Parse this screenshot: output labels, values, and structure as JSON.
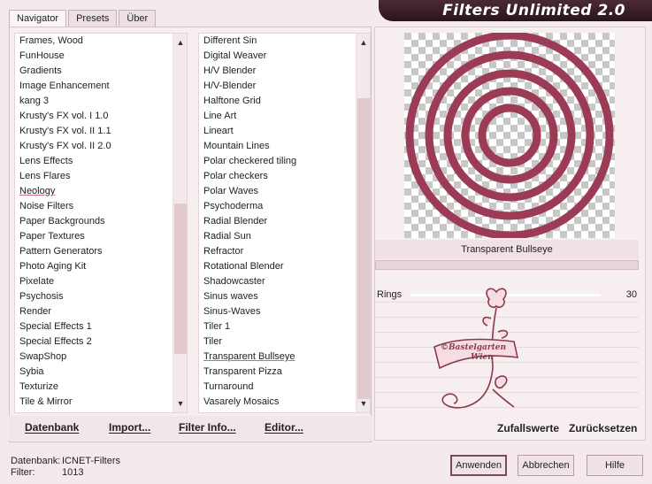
{
  "app": {
    "title": "Filters Unlimited 2.0"
  },
  "tabs": [
    "Navigator",
    "Presets",
    "Über"
  ],
  "categories": [
    "Frames, Wood",
    "FunHouse",
    "Gradients",
    "Image Enhancement",
    "kang 3",
    "Krusty's FX vol. I 1.0",
    "Krusty's FX vol. II 1.1",
    "Krusty's FX vol. II 2.0",
    "Lens Effects",
    "Lens Flares",
    "Neology",
    "Noise Filters",
    "Paper Backgrounds",
    "Paper Textures",
    "Pattern Generators",
    "Photo Aging Kit",
    "Pixelate",
    "Psychosis",
    "Render",
    "Special Effects 1",
    "Special Effects 2",
    "SwapShop",
    "Sybia",
    "Texturize",
    "Tile & Mirror"
  ],
  "filters": [
    "Different Sin",
    "Digital Weaver",
    "H/V Blender",
    "H/V-Blender",
    "Halftone Grid",
    "Line Art",
    "Lineart",
    "Mountain Lines",
    "Polar checkered tiling",
    "Polar checkers",
    "Polar Waves",
    "Psychoderma",
    "Radial Blender",
    "Radial Sun",
    "Refractor",
    "Rotational Blender",
    "Shadowcaster",
    "Sinus waves",
    "Sinus-Waves",
    "Tiler 1",
    "Tiler",
    "Transparent Bullseye",
    "Transparent Pizza",
    "Turnaround",
    "Vasarely Mosaics"
  ],
  "selected": {
    "category": "Neology",
    "filter": "Transparent Bullseye"
  },
  "toolbar": {
    "datenbank": "Datenbank",
    "import": "Import...",
    "filterinfo": "Filter Info...",
    "editor": "Editor..."
  },
  "preview": {
    "filter_name": "Transparent Bullseye",
    "ring_color": "#9b3b55"
  },
  "params": [
    {
      "label": "Rings",
      "value": "30"
    }
  ],
  "watermark": {
    "line1": "©Bastelgarten",
    "line2": "Wien"
  },
  "right_buttons": {
    "random": "Zufallswerte",
    "reset": "Zurücksetzen"
  },
  "status": {
    "db_label": "Datenbank:",
    "db_value": "ICNET-Filters",
    "filter_label": "Filter:",
    "filter_value": "1013"
  },
  "buttons": {
    "apply": "Anwenden",
    "cancel": "Abbrechen",
    "help": "Hilfe"
  }
}
